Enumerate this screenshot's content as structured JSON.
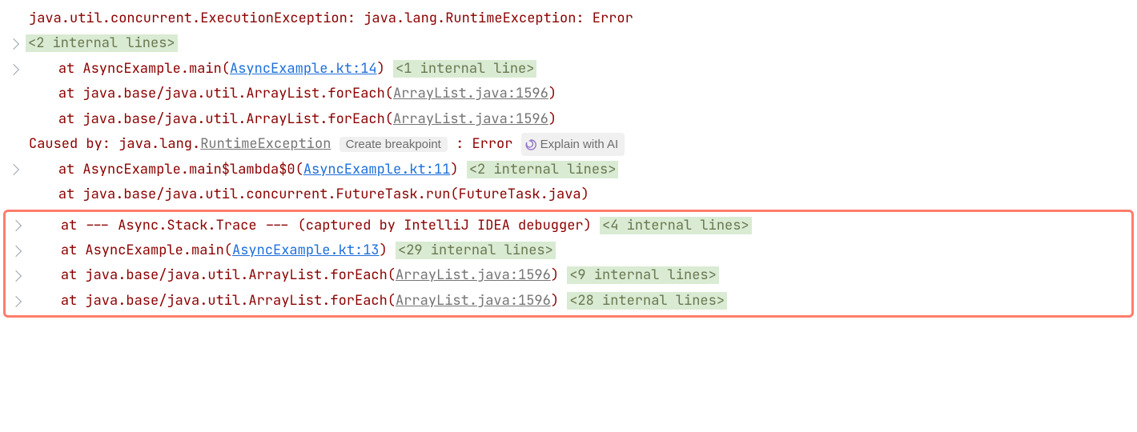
{
  "lines": {
    "l1_exception": "java.util.concurrent.ExecutionException: java.lang.RuntimeException: Error",
    "l2_fold": "<2 internal lines>",
    "l3_prefix": "at AsyncExample.main(",
    "l3_link": "AsyncExample.kt:14",
    "l3_close": ")",
    "l3_fold": "<1 internal line>",
    "l4_prefix": "at java.base/java.util.ArrayList.forEach(",
    "l4_link": "ArrayList.java:1596",
    "l4_close": ")",
    "l5_prefix": "at java.base/java.util.ArrayList.forEach(",
    "l5_link": "ArrayList.java:1596",
    "l5_close": ")",
    "l6_caused": "Caused by: java.lang.",
    "l6_exc": "RuntimeException",
    "l6_badge": "Create breakpoint",
    "l6_colon": ": Error",
    "l6_ai": "Explain with AI",
    "l7_prefix": "at AsyncExample.main$lambda$0(",
    "l7_link": "AsyncExample.kt:11",
    "l7_close": ")",
    "l7_fold": "<2 internal lines>",
    "l8_text": "at java.base/java.util.concurrent.FutureTask.run(FutureTask.java)",
    "l9_text": "at --- Async.Stack.Trace --- (captured by IntelliJ IDEA debugger)",
    "l9_fold": "<4 internal lines>",
    "l10_prefix": "at AsyncExample.main(",
    "l10_link": "AsyncExample.kt:13",
    "l10_close": ")",
    "l10_fold": "<29 internal lines>",
    "l11_prefix": "at java.base/java.util.ArrayList.forEach(",
    "l11_link": "ArrayList.java:1596",
    "l11_close": ")",
    "l11_fold": "<9 internal lines>",
    "l12_prefix": "at java.base/java.util.ArrayList.forEach(",
    "l12_link": "ArrayList.java:1596",
    "l12_close": ")",
    "l12_fold": "<28 internal lines>"
  }
}
